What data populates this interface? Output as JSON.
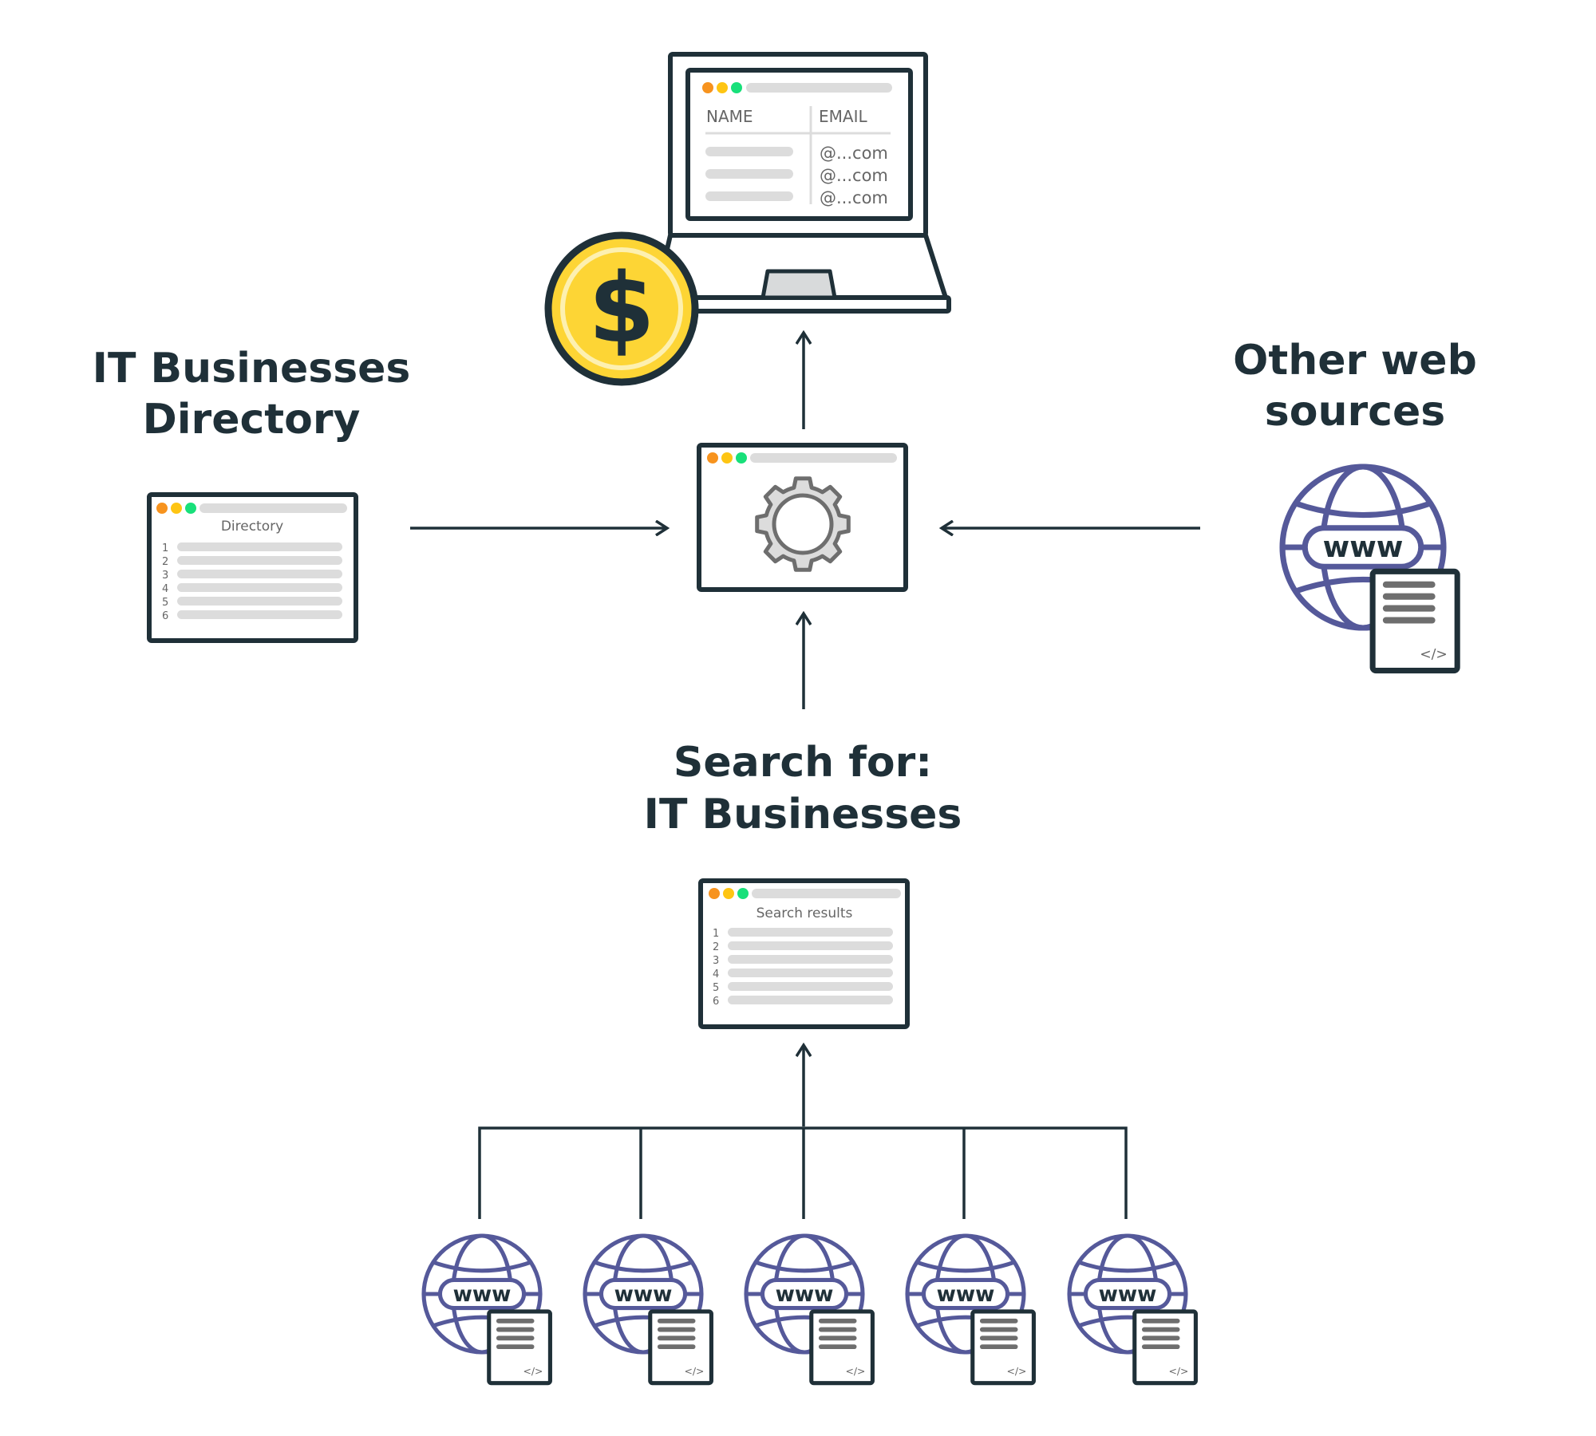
{
  "colors": {
    "ink": "#1f3038",
    "globe": "#55599a",
    "gray_text": "#666666",
    "pill": "#dcdcdc",
    "gear_stroke": "#6e6e6e",
    "gear_fill": "#dcdcdc",
    "coin": "#fdd535",
    "coin_ring": "#fdf0b0",
    "dot_orange": "#f7931e",
    "dot_yellow": "#fec513",
    "dot_green": "#18e07a"
  },
  "laptop": {
    "col_name": "NAME",
    "col_email": "EMAIL",
    "emails": [
      "@...com",
      "@...com",
      "@...com"
    ]
  },
  "coin": {
    "symbol": "$"
  },
  "labels": {
    "directory": [
      "IT Businesses",
      "Directory"
    ],
    "other": [
      "Other web",
      "sources"
    ],
    "search": [
      "Search for:",
      "IT Businesses"
    ]
  },
  "directory_window": {
    "title": "Directory",
    "rows": [
      "1",
      "2",
      "3",
      "4",
      "5",
      "6"
    ]
  },
  "search_window": {
    "title": "Search results",
    "rows": [
      "1",
      "2",
      "3",
      "4",
      "5",
      "6"
    ]
  },
  "web_source": {
    "globe_text": "www",
    "doc_code": "</>"
  },
  "bottom_sources_count": 5
}
